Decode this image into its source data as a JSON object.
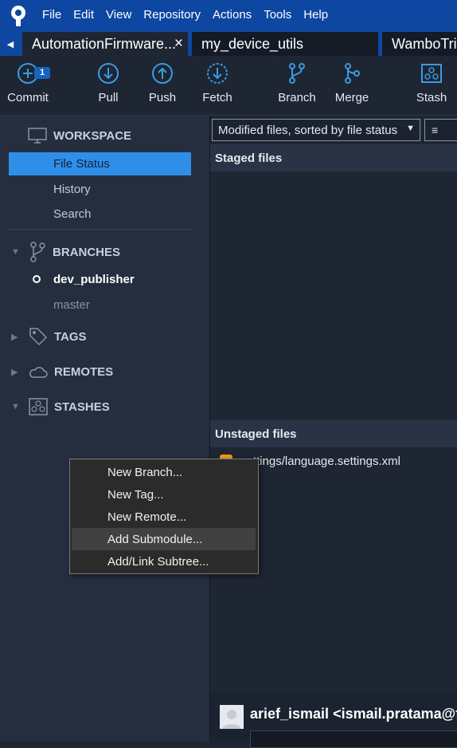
{
  "menu": [
    "File",
    "Edit",
    "View",
    "Repository",
    "Actions",
    "Tools",
    "Help"
  ],
  "tabs": [
    {
      "label": "AutomationFirmware...",
      "close": "×"
    },
    {
      "label": "my_device_utils"
    },
    {
      "label": "WamboTrin"
    }
  ],
  "toolbar": {
    "commit": "Commit",
    "commit_badge": "1",
    "pull": "Pull",
    "push": "Push",
    "fetch": "Fetch",
    "branch": "Branch",
    "merge": "Merge",
    "stash": "Stash"
  },
  "sidebar": {
    "workspace": "WORKSPACE",
    "workspace_items": [
      "File Status",
      "History",
      "Search"
    ],
    "branches": "BRANCHES",
    "branch_items": [
      "dev_publisher",
      "master"
    ],
    "tags": "TAGS",
    "remotes": "REMOTES",
    "stashes": "STASHES"
  },
  "content": {
    "filter_value": "Modified files, sorted by file status",
    "view_icon": "≡",
    "staged_header": "Staged files",
    "unstaged_header": "Unstaged files",
    "unstaged_file": "settings/language.settings.xml",
    "author": "arief_ismail <ismail.pratama@fo"
  },
  "context_menu": [
    "New Branch...",
    "New Tag...",
    "New Remote...",
    "Add Submodule...",
    "Add/Link Subtree..."
  ],
  "colors": {
    "titlebar": "#0d47a1",
    "accent": "#2f8ee8",
    "icon_blue": "#3a9be0",
    "file_modified": "#f09a1f"
  }
}
